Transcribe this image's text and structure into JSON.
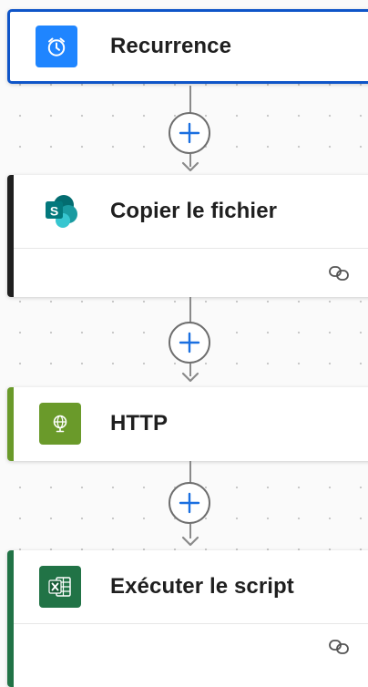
{
  "flow": {
    "steps": [
      {
        "title": "Recurrence",
        "icon": "alarm-clock-icon",
        "icon_color": "#1f85ff",
        "accent_color": "#0f55c8",
        "selected": true,
        "has_footer": false
      },
      {
        "title": "Copier le fichier",
        "icon": "sharepoint-icon",
        "icon_color": "#ffffff",
        "accent_color": "#1f1f1f",
        "selected": false,
        "has_footer": true,
        "footer_icon": "link-icon"
      },
      {
        "title": "HTTP",
        "icon": "globe-icon",
        "icon_color": "#6a9a2a",
        "accent_color": "#6a9a2a",
        "selected": false,
        "has_footer": false
      },
      {
        "title": "Exécuter le script",
        "icon": "excel-icon",
        "icon_color": "#217346",
        "accent_color": "#217346",
        "selected": false,
        "has_footer": true,
        "footer_icon": "link-icon"
      }
    ],
    "add_button_icon": "plus-icon",
    "add_button_color": "#1a6fe0",
    "canvas_dot_color": "#c4c4c4"
  }
}
